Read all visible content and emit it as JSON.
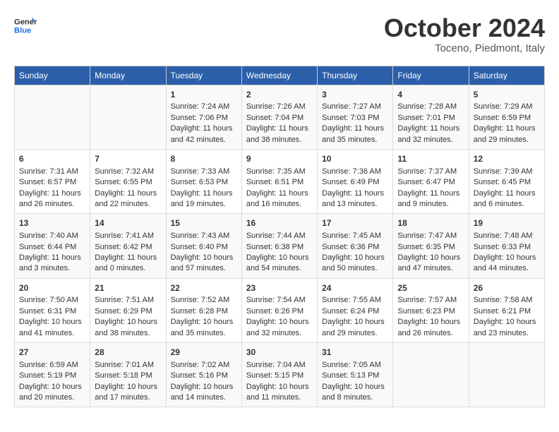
{
  "header": {
    "logo_line1": "General",
    "logo_line2": "Blue",
    "month_title": "October 2024",
    "location": "Toceno, Piedmont, Italy"
  },
  "days_of_week": [
    "Sunday",
    "Monday",
    "Tuesday",
    "Wednesday",
    "Thursday",
    "Friday",
    "Saturday"
  ],
  "weeks": [
    [
      {
        "day": "",
        "info": ""
      },
      {
        "day": "",
        "info": ""
      },
      {
        "day": "1",
        "info": "Sunrise: 7:24 AM\nSunset: 7:06 PM\nDaylight: 11 hours and 42 minutes."
      },
      {
        "day": "2",
        "info": "Sunrise: 7:26 AM\nSunset: 7:04 PM\nDaylight: 11 hours and 38 minutes."
      },
      {
        "day": "3",
        "info": "Sunrise: 7:27 AM\nSunset: 7:03 PM\nDaylight: 11 hours and 35 minutes."
      },
      {
        "day": "4",
        "info": "Sunrise: 7:28 AM\nSunset: 7:01 PM\nDaylight: 11 hours and 32 minutes."
      },
      {
        "day": "5",
        "info": "Sunrise: 7:29 AM\nSunset: 6:59 PM\nDaylight: 11 hours and 29 minutes."
      }
    ],
    [
      {
        "day": "6",
        "info": "Sunrise: 7:31 AM\nSunset: 6:57 PM\nDaylight: 11 hours and 26 minutes."
      },
      {
        "day": "7",
        "info": "Sunrise: 7:32 AM\nSunset: 6:55 PM\nDaylight: 11 hours and 22 minutes."
      },
      {
        "day": "8",
        "info": "Sunrise: 7:33 AM\nSunset: 6:53 PM\nDaylight: 11 hours and 19 minutes."
      },
      {
        "day": "9",
        "info": "Sunrise: 7:35 AM\nSunset: 6:51 PM\nDaylight: 11 hours and 16 minutes."
      },
      {
        "day": "10",
        "info": "Sunrise: 7:36 AM\nSunset: 6:49 PM\nDaylight: 11 hours and 13 minutes."
      },
      {
        "day": "11",
        "info": "Sunrise: 7:37 AM\nSunset: 6:47 PM\nDaylight: 11 hours and 9 minutes."
      },
      {
        "day": "12",
        "info": "Sunrise: 7:39 AM\nSunset: 6:45 PM\nDaylight: 11 hours and 6 minutes."
      }
    ],
    [
      {
        "day": "13",
        "info": "Sunrise: 7:40 AM\nSunset: 6:44 PM\nDaylight: 11 hours and 3 minutes."
      },
      {
        "day": "14",
        "info": "Sunrise: 7:41 AM\nSunset: 6:42 PM\nDaylight: 11 hours and 0 minutes."
      },
      {
        "day": "15",
        "info": "Sunrise: 7:43 AM\nSunset: 6:40 PM\nDaylight: 10 hours and 57 minutes."
      },
      {
        "day": "16",
        "info": "Sunrise: 7:44 AM\nSunset: 6:38 PM\nDaylight: 10 hours and 54 minutes."
      },
      {
        "day": "17",
        "info": "Sunrise: 7:45 AM\nSunset: 6:36 PM\nDaylight: 10 hours and 50 minutes."
      },
      {
        "day": "18",
        "info": "Sunrise: 7:47 AM\nSunset: 6:35 PM\nDaylight: 10 hours and 47 minutes."
      },
      {
        "day": "19",
        "info": "Sunrise: 7:48 AM\nSunset: 6:33 PM\nDaylight: 10 hours and 44 minutes."
      }
    ],
    [
      {
        "day": "20",
        "info": "Sunrise: 7:50 AM\nSunset: 6:31 PM\nDaylight: 10 hours and 41 minutes."
      },
      {
        "day": "21",
        "info": "Sunrise: 7:51 AM\nSunset: 6:29 PM\nDaylight: 10 hours and 38 minutes."
      },
      {
        "day": "22",
        "info": "Sunrise: 7:52 AM\nSunset: 6:28 PM\nDaylight: 10 hours and 35 minutes."
      },
      {
        "day": "23",
        "info": "Sunrise: 7:54 AM\nSunset: 6:26 PM\nDaylight: 10 hours and 32 minutes."
      },
      {
        "day": "24",
        "info": "Sunrise: 7:55 AM\nSunset: 6:24 PM\nDaylight: 10 hours and 29 minutes."
      },
      {
        "day": "25",
        "info": "Sunrise: 7:57 AM\nSunset: 6:23 PM\nDaylight: 10 hours and 26 minutes."
      },
      {
        "day": "26",
        "info": "Sunrise: 7:58 AM\nSunset: 6:21 PM\nDaylight: 10 hours and 23 minutes."
      }
    ],
    [
      {
        "day": "27",
        "info": "Sunrise: 6:59 AM\nSunset: 5:19 PM\nDaylight: 10 hours and 20 minutes."
      },
      {
        "day": "28",
        "info": "Sunrise: 7:01 AM\nSunset: 5:18 PM\nDaylight: 10 hours and 17 minutes."
      },
      {
        "day": "29",
        "info": "Sunrise: 7:02 AM\nSunset: 5:16 PM\nDaylight: 10 hours and 14 minutes."
      },
      {
        "day": "30",
        "info": "Sunrise: 7:04 AM\nSunset: 5:15 PM\nDaylight: 10 hours and 11 minutes."
      },
      {
        "day": "31",
        "info": "Sunrise: 7:05 AM\nSunset: 5:13 PM\nDaylight: 10 hours and 8 minutes."
      },
      {
        "day": "",
        "info": ""
      },
      {
        "day": "",
        "info": ""
      }
    ]
  ]
}
